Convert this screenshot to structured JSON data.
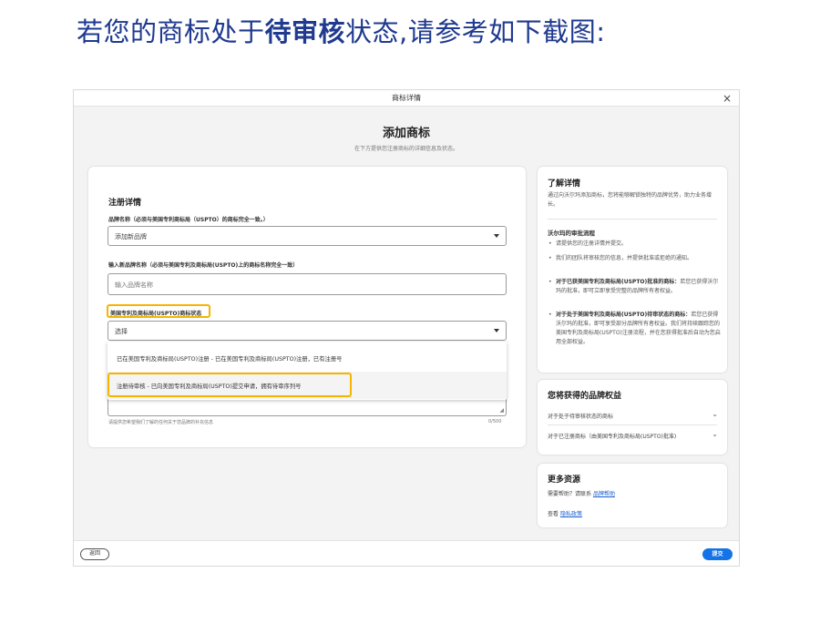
{
  "heading": {
    "prefix": "若您的商标处于",
    "bold": "待审核",
    "suffix": "状态,请参考如下截图:"
  },
  "window": {
    "title": "商标详情",
    "close_glyph": "×"
  },
  "page": {
    "title": "添加商标",
    "subtitle": "在下方提供您注册商标的详细信息及状态。"
  },
  "form": {
    "section_title": "注册详情",
    "brand_name_label": "品牌名称（必须与美国专利商标局（USPTO）的商标完全一致。）",
    "brand_select_value": "添加新品牌",
    "new_brand_label": "输入新品牌名称（必须与美国专利及商标局(USPTO)上的商标名称完全一致）",
    "new_brand_placeholder": "输入品牌名称",
    "status_label": "美国专利及商标局(USPTO)商标状态",
    "status_select_value": "选择",
    "status_options": [
      "已在美国专利及商标局(USPTO)注册 - 已在美国专利及商标局(USPTO)注册，已有注册号",
      "注册待审核 - 已向美国专利及商标局(USPTO)提交申请，拥有待审序列号"
    ],
    "notes_hint": "请提供您希望我们了解的任何关于您品牌的补充信息",
    "notes_count": "0/500"
  },
  "side_learn": {
    "title": "了解详情",
    "intro": "通过向沃尔玛添加商标，您将能够解锁独特的品牌优势，助力业务增长。",
    "process_title": "沃尔玛的审批流程",
    "bullets": [
      {
        "bold": "",
        "text": "请提供您的注册详情并提交。"
      },
      {
        "bold": "",
        "text": "我们的团队将审核您的信息，并提供批准或拒绝的通知。"
      },
      {
        "bold": "对于已获美国专利及商标局(USPTO)批准的商标：",
        "text": "若您已获得沃尔玛的批准，即可立即享受完整的品牌所有者权益。"
      },
      {
        "bold": "对于处于美国专利及商标局(USPTO)待审状态的商标：",
        "text": "若您已获得沃尔玛的批准，即可享受部分品牌所有者权益。我们将持续跟踪您的美国专利及商标局(USPTO)注册流程，并在您获得批准后自动为您启用全部权益。"
      }
    ]
  },
  "side_benefits": {
    "title": "您将获得的品牌权益",
    "items": [
      "对于处于待审核状态的商标",
      "对于已注册商标（由美国专利及商标局(USPTO)批准)"
    ]
  },
  "side_resources": {
    "title": "更多资源",
    "help_prefix": "需要帮助？请联系",
    "help_link": "品牌帮助",
    "privacy_prefix": "查看",
    "privacy_link": "隐私政策"
  },
  "footer": {
    "back_label": "返回",
    "submit_label": "提交"
  },
  "colors": {
    "heading": "#1f3a8f",
    "highlight": "#f5b400",
    "primary_button": "#1473e6",
    "link": "#1a5fcf"
  }
}
